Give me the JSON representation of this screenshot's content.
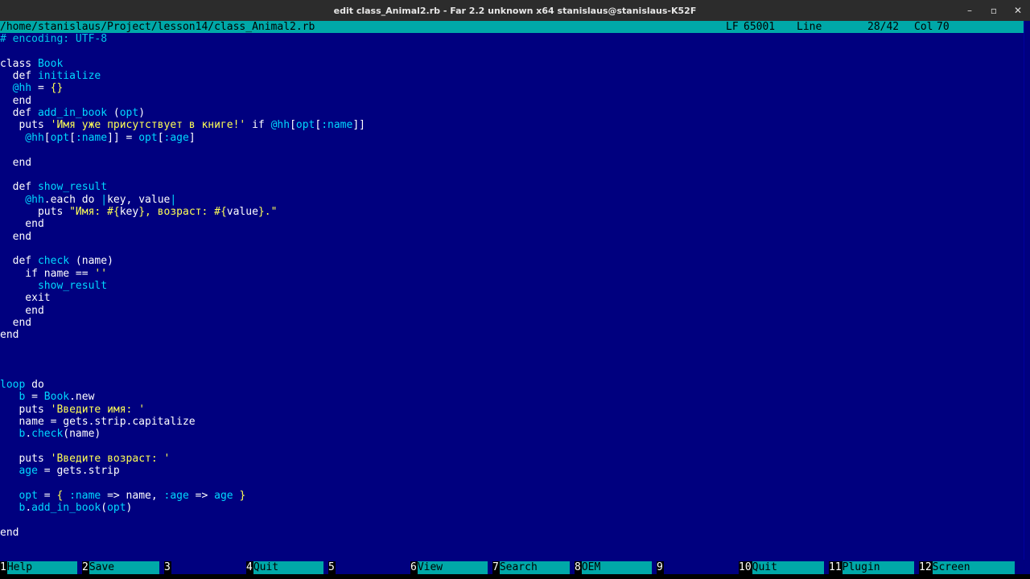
{
  "window": {
    "title": "edit class_Animal2.rb - Far 2.2 unknown x64 stanislaus@stanislaus-K52F",
    "controls": [
      "–",
      "▫",
      "✕"
    ]
  },
  "status": {
    "path": "/home/stanislaus/Project/lesson14/class_Animal2.rb",
    "eol": "LF",
    "codepage": "65001",
    "line_label": "Line",
    "line_pos": "28/42",
    "col_label": "Col",
    "col_pos": "70"
  },
  "code_lines": [
    {
      "row": 0,
      "parts": [
        [
          "c",
          "# encoding: UTF-8"
        ]
      ]
    },
    {
      "row": 2,
      "parts": [
        [
          "k",
          "class "
        ],
        [
          "i",
          "Book"
        ]
      ]
    },
    {
      "row": 3,
      "parts": [
        [
          "k",
          "  def "
        ],
        [
          "i",
          "initialize"
        ]
      ]
    },
    {
      "row": 4,
      "parts": [
        [
          "i",
          "  @hh"
        ],
        [
          "k",
          " = "
        ],
        [
          "s",
          "{}"
        ]
      ]
    },
    {
      "row": 5,
      "parts": [
        [
          "k",
          "  end"
        ]
      ]
    },
    {
      "row": 6,
      "parts": [
        [
          "k",
          "  def "
        ],
        [
          "i",
          "add_in_book"
        ],
        [
          "k",
          " ("
        ],
        [
          "i",
          "opt"
        ],
        [
          "k",
          ")"
        ]
      ]
    },
    {
      "row": 7,
      "parts": [
        [
          "k",
          "   puts "
        ],
        [
          "s",
          "'Имя уже присутствует в книге!'"
        ],
        [
          "k",
          " if "
        ],
        [
          "i",
          "@hh"
        ],
        [
          "k",
          "["
        ],
        [
          "i",
          "opt"
        ],
        [
          "k",
          "["
        ],
        [
          "i",
          ":name"
        ],
        [
          "k",
          "]]"
        ]
      ]
    },
    {
      "row": 8,
      "parts": [
        [
          "i",
          "    @hh"
        ],
        [
          "k",
          "["
        ],
        [
          "i",
          "opt"
        ],
        [
          "k",
          "["
        ],
        [
          "i",
          ":name"
        ],
        [
          "k",
          "]] = "
        ],
        [
          "i",
          "opt"
        ],
        [
          "k",
          "["
        ],
        [
          "i",
          ":age"
        ],
        [
          "k",
          "]"
        ]
      ]
    },
    {
      "row": 10,
      "parts": [
        [
          "k",
          "  end"
        ]
      ]
    },
    {
      "row": 12,
      "parts": [
        [
          "k",
          "  def "
        ],
        [
          "i",
          "show_result"
        ]
      ]
    },
    {
      "row": 13,
      "parts": [
        [
          "i",
          "    @hh"
        ],
        [
          "k",
          ".each do "
        ],
        [
          "i",
          "|"
        ],
        [
          "k",
          "key, value"
        ],
        [
          "i",
          "|"
        ]
      ]
    },
    {
      "row": 14,
      "parts": [
        [
          "k",
          "      puts "
        ],
        [
          "s",
          "\"Имя: #{"
        ],
        [
          "k",
          "key"
        ],
        [
          "s",
          "}, возраст: #{"
        ],
        [
          "k",
          "value"
        ],
        [
          "s",
          "}.\""
        ]
      ]
    },
    {
      "row": 15,
      "parts": [
        [
          "k",
          "    end"
        ]
      ]
    },
    {
      "row": 16,
      "parts": [
        [
          "k",
          "  end"
        ]
      ]
    },
    {
      "row": 18,
      "parts": [
        [
          "k",
          "  def "
        ],
        [
          "i",
          "check"
        ],
        [
          "k",
          " (name)"
        ]
      ]
    },
    {
      "row": 19,
      "parts": [
        [
          "k",
          "    if name == "
        ],
        [
          "s",
          "''"
        ]
      ]
    },
    {
      "row": 20,
      "parts": [
        [
          "i",
          "      show_result"
        ]
      ]
    },
    {
      "row": 21,
      "parts": [
        [
          "k",
          "    exit"
        ]
      ]
    },
    {
      "row": 22,
      "parts": [
        [
          "k",
          "    end"
        ]
      ]
    },
    {
      "row": 23,
      "parts": [
        [
          "k",
          "  end"
        ]
      ]
    },
    {
      "row": 24,
      "parts": [
        [
          "k",
          "end"
        ]
      ]
    },
    {
      "row": 28,
      "parts": [
        [
          "i",
          "loop"
        ],
        [
          "k",
          " do"
        ]
      ]
    },
    {
      "row": 29,
      "parts": [
        [
          "i",
          "   b"
        ],
        [
          "k",
          " = "
        ],
        [
          "i",
          "Book"
        ],
        [
          "k",
          ".new"
        ]
      ]
    },
    {
      "row": 30,
      "parts": [
        [
          "k",
          "   puts "
        ],
        [
          "s",
          "'Введите имя: '"
        ]
      ]
    },
    {
      "row": 31,
      "parts": [
        [
          "k",
          "   name = gets.strip.capitalize"
        ]
      ]
    },
    {
      "row": 32,
      "parts": [
        [
          "i",
          "   b"
        ],
        [
          "k",
          "."
        ],
        [
          "i",
          "check"
        ],
        [
          "k",
          "(name)"
        ]
      ]
    },
    {
      "row": 34,
      "parts": [
        [
          "k",
          "   puts "
        ],
        [
          "s",
          "'Введите возраст: '"
        ]
      ]
    },
    {
      "row": 35,
      "parts": [
        [
          "i",
          "   age"
        ],
        [
          "k",
          " = gets.strip"
        ]
      ]
    },
    {
      "row": 37,
      "parts": [
        [
          "i",
          "   opt"
        ],
        [
          "k",
          " = "
        ],
        [
          "s",
          "{"
        ],
        [
          "i",
          " :name"
        ],
        [
          "k",
          " => name, "
        ],
        [
          "i",
          ":age"
        ],
        [
          "k",
          " => "
        ],
        [
          "i",
          "age"
        ],
        [
          "s",
          " }"
        ]
      ]
    },
    {
      "row": 38,
      "parts": [
        [
          "i",
          "   b"
        ],
        [
          "k",
          "."
        ],
        [
          "i",
          "add_in_book"
        ],
        [
          "k",
          "("
        ],
        [
          "i",
          "opt"
        ],
        [
          "k",
          ")"
        ]
      ]
    },
    {
      "row": 40,
      "parts": [
        [
          "k",
          "end"
        ]
      ]
    }
  ],
  "fkeys": [
    {
      "num": "1",
      "label": "Help"
    },
    {
      "num": "2",
      "label": "Save"
    },
    {
      "num": "3",
      "label": ""
    },
    {
      "num": "4",
      "label": "Quit"
    },
    {
      "num": "5",
      "label": ""
    },
    {
      "num": "6",
      "label": "View"
    },
    {
      "num": "7",
      "label": "Search"
    },
    {
      "num": "8",
      "label": "OEM"
    },
    {
      "num": "9",
      "label": ""
    },
    {
      "num": "10",
      "label": "Quit"
    },
    {
      "num": "11",
      "label": "Plugin"
    },
    {
      "num": "12",
      "label": "Screen"
    }
  ],
  "colors": {
    "background": "#00007f",
    "status_bar": "#00a8a8",
    "string": "#ffff55",
    "identifier": "#00d8ff",
    "comment": "#00c8e8"
  }
}
